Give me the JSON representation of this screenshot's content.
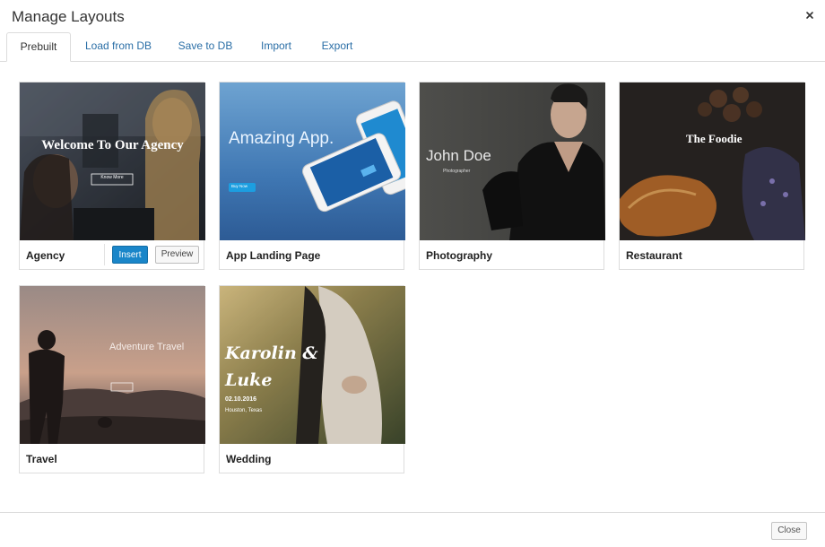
{
  "dialog": {
    "title": "Manage Layouts",
    "close_icon": "close-icon"
  },
  "tabs": [
    {
      "label": "Prebuilt",
      "active": true
    },
    {
      "label": "Load from DB",
      "active": false
    },
    {
      "label": "Save to DB",
      "active": false
    },
    {
      "label": "Import",
      "active": false
    },
    {
      "label": "Export",
      "active": false
    }
  ],
  "layouts": [
    {
      "name": "Agency",
      "insert_label": "Insert",
      "preview_label": "Preview",
      "thumb": {
        "heading": "Welcome To Our Agency",
        "button": "Know More"
      }
    },
    {
      "name": "App Landing Page",
      "thumb": {
        "heading": "Amazing App.",
        "button": "Buy Now"
      }
    },
    {
      "name": "Photography",
      "thumb": {
        "heading": "John Doe",
        "sub": "Photographer"
      }
    },
    {
      "name": "Restaurant",
      "thumb": {
        "heading": "The Foodie"
      }
    },
    {
      "name": "Travel",
      "thumb": {
        "heading": "Adventure Travel"
      }
    },
    {
      "name": "Wedding",
      "thumb": {
        "heading": "Karolin &",
        "heading2": "Luke",
        "date": "02.10.2016",
        "place": "Houston, Texas"
      }
    }
  ],
  "footer": {
    "close_label": "Close"
  },
  "colors": {
    "accent": "#1a86c9",
    "tab_link": "#2a6ea6"
  }
}
